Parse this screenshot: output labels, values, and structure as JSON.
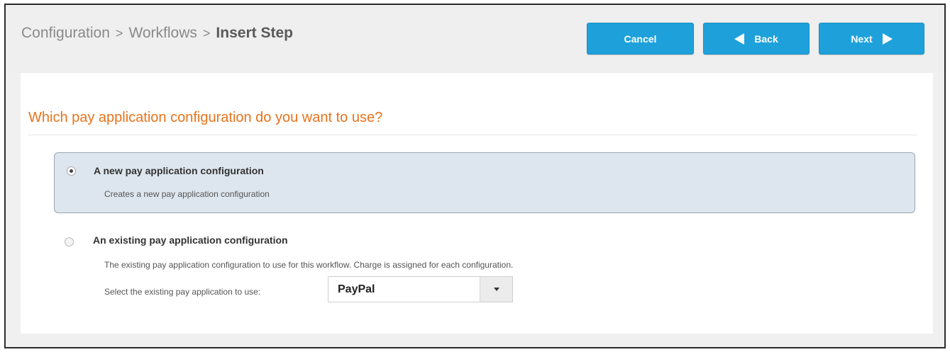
{
  "breadcrumb": {
    "items": [
      "Configuration",
      "Workflows"
    ],
    "separator": ">",
    "current": "Insert Step"
  },
  "toolbar": {
    "cancel_label": "Cancel",
    "back_label": "Back",
    "next_label": "Next",
    "back_icon": "triangle-left-icon",
    "next_icon": "triangle-right-icon",
    "button_color": "#1ea1db"
  },
  "question": {
    "text": "Which pay application configuration do you want to use?",
    "color": "#e8731c"
  },
  "options": [
    {
      "title": "A new pay application configuration",
      "description": "Creates a new pay application configuration",
      "selected": true
    },
    {
      "title": "An existing pay application configuration",
      "description": "The existing pay application configuration to use for this workflow. Charge is assigned for each configuration.",
      "selected": false
    }
  ],
  "existing_select": {
    "label": "Select the existing pay application to use:",
    "value": "PayPal"
  }
}
